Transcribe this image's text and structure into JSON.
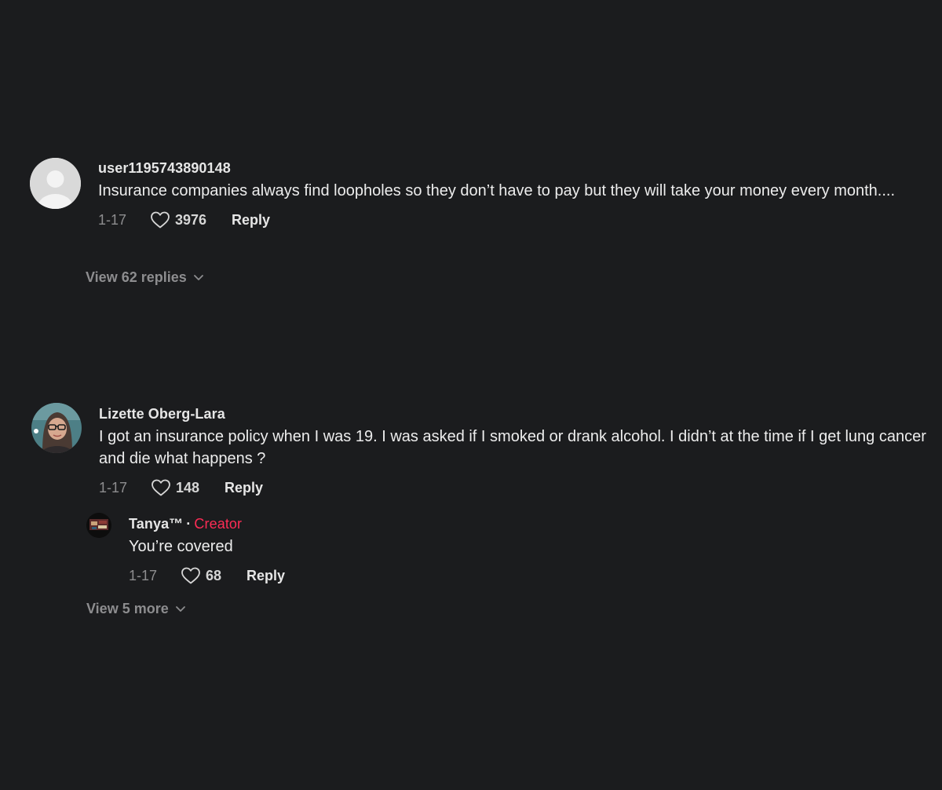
{
  "comments": [
    {
      "username": "user1195743890148",
      "text": "Insurance companies always find loopholes so they don’t have to pay but they will take your money every month....",
      "date": "1-17",
      "likes": "3976",
      "reply_label": "Reply",
      "view_replies": "View 62 replies",
      "avatar_icon": "default-user-avatar"
    },
    {
      "username": "Lizette Oberg-Lara",
      "text": "I got an insurance policy when I was 19. I was asked if I smoked or drank alcohol. I didn’t at the time if I get lung cancer and die what happens ?",
      "date": "1-17",
      "likes": "148",
      "reply_label": "Reply",
      "avatar_icon": "profile-photo",
      "replies": [
        {
          "username": "Tanya™",
          "separator": "·",
          "badge": "Creator",
          "text": "You’re covered",
          "date": "1-17",
          "likes": "68",
          "reply_label": "Reply",
          "avatar_icon": "profile-photo"
        }
      ],
      "view_more": "View 5 more"
    }
  ],
  "colors": {
    "background": "#1b1c1e",
    "creator_badge": "#fe2c55",
    "muted_text": "#8d8d8f"
  }
}
